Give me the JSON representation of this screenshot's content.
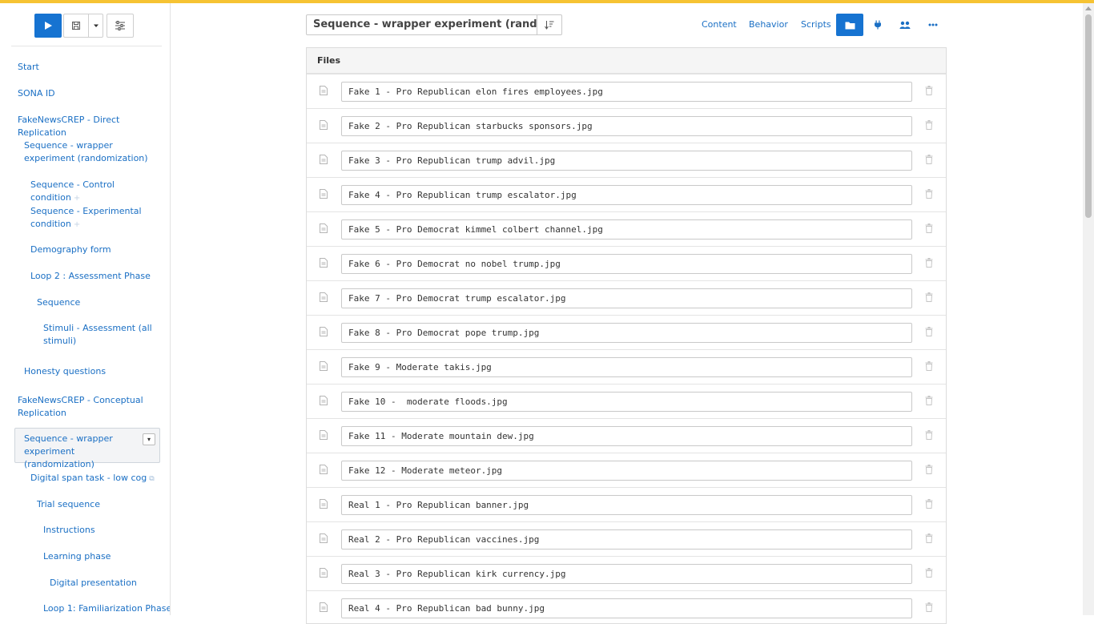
{
  "sidebar": {
    "tree": [
      {
        "label": "Start"
      },
      {
        "label": "SONA ID"
      },
      {
        "label": "FakeNewsCREP - Direct Replication"
      },
      {
        "label": "Sequence - wrapper experiment (randomization)"
      },
      {
        "label": "Sequence - Control condition",
        "marker": "+"
      },
      {
        "label": "Sequence - Experimental condition",
        "marker": "+"
      },
      {
        "label": "Demography form"
      },
      {
        "label": "Loop 2 : Assessment Phase"
      },
      {
        "label": "Sequence"
      },
      {
        "label": "Stimuli - Assessment (all stimuli)"
      },
      {
        "label": "Honesty questions"
      },
      {
        "label": "FakeNewsCREP - Conceptual Replication"
      },
      {
        "label": "Sequence - wrapper experiment (randomization)"
      },
      {
        "label": "Digital span task - low cog",
        "icon": "external-link-icon"
      },
      {
        "label": "Trial sequence"
      },
      {
        "label": "Instructions"
      },
      {
        "label": "Learning phase"
      },
      {
        "label": "Digital presentation"
      },
      {
        "label": "Loop 1: Familiarization Phase"
      }
    ]
  },
  "header": {
    "title": "Sequence - wrapper experiment (randomization)",
    "nav": {
      "content": "Content",
      "behavior": "Behavior",
      "scripts": "Scripts"
    }
  },
  "files": {
    "heading": "Files",
    "items": [
      "Fake 1 - Pro Republican elon fires employees.jpg",
      "Fake 2 - Pro Republican starbucks sponsors.jpg",
      "Fake 3 - Pro Republican trump advil.jpg",
      "Fake 4 - Pro Republican trump escalator.jpg",
      "Fake 5 - Pro Democrat kimmel colbert channel.jpg",
      "Fake 6 - Pro Democrat no nobel trump.jpg",
      "Fake 7 - Pro Democrat trump escalator.jpg",
      "Fake 8 - Pro Democrat pope trump.jpg",
      "Fake 9 - Moderate takis.jpg",
      "Fake 10 -  moderate floods.jpg",
      "Fake 11 - Moderate mountain dew.jpg",
      "Fake 12 - Moderate meteor.jpg",
      "Real 1 - Pro Republican banner.jpg",
      "Real 2 - Pro Republican vaccines.jpg",
      "Real 3 - Pro Republican kirk currency.jpg",
      "Real 4 - Pro Republican bad bunny.jpg"
    ]
  },
  "colors": {
    "accent": "#1673d1",
    "top_bar": "#f6c333",
    "link": "#1a6fc4"
  }
}
